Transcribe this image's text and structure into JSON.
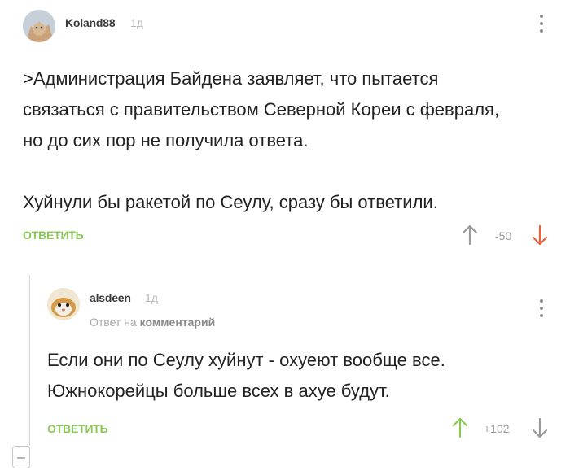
{
  "comments": [
    {
      "username": "Koland88",
      "time": "1д",
      "text_lines": [
        ">Администрация Байдена заявляет, что пытается",
        "связаться с правительством Северной Кореи с февраля,",
        "но до сих пор не получила ответа.",
        "Хуйнули бы ракетой по Сеулу, сразу бы ответили."
      ],
      "reply_label": "ОТВЕТИТЬ",
      "rating": "-50"
    },
    {
      "username": "alsdeen",
      "time": "1д",
      "reply_to_prefix": "Ответ на",
      "reply_to_link": "комментарий",
      "text_lines": [
        "Если они по Сеулу хуйнут - охуеют вообще все.",
        "Южнокорейцы больше всех в ахуе будут."
      ],
      "reply_label": "ОТВЕТИТЬ",
      "rating": "+102"
    }
  ],
  "colors": {
    "accent_green": "#8ac858",
    "downvote_red": "#e8603c",
    "upvote_green": "#8ac858",
    "neutral_icon": "#9a9a9a"
  },
  "icons": {
    "upvote": "arrow-up-icon",
    "downvote": "arrow-down-icon",
    "menu": "kebab-menu-icon",
    "collapse": "collapse-thread-icon"
  }
}
